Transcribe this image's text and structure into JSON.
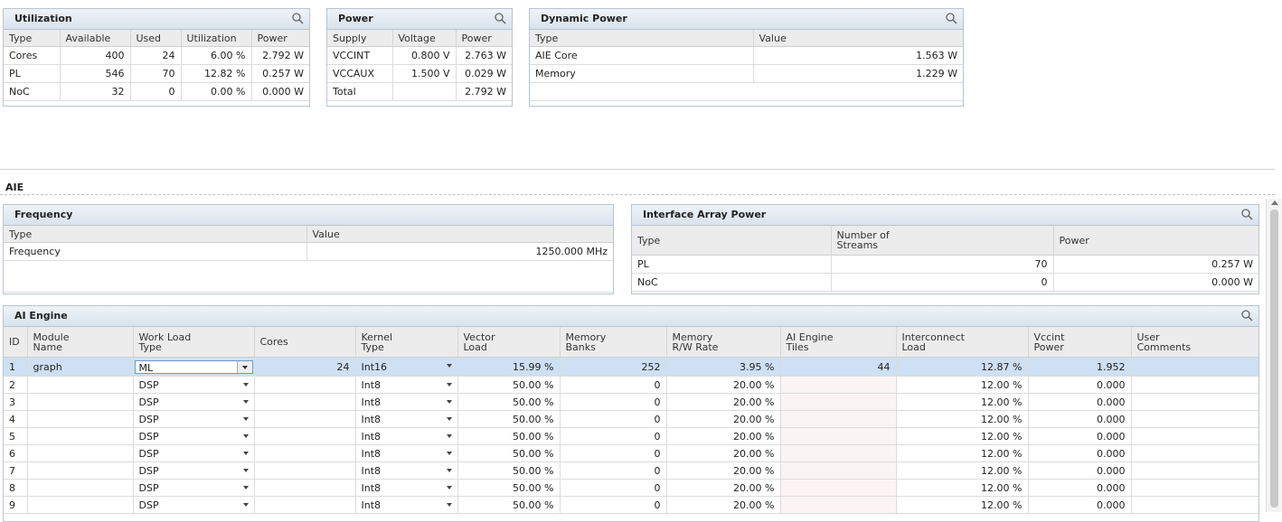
{
  "utilization": {
    "title": "Utilization",
    "headers": [
      "Type",
      "Available",
      "Used",
      "Utilization",
      "Power"
    ],
    "rows": [
      [
        "Cores",
        "400",
        "24",
        "6.00 %",
        "2.792 W"
      ],
      [
        "PL",
        "546",
        "70",
        "12.82 %",
        "0.257 W"
      ],
      [
        "NoC",
        "32",
        "0",
        "0.00 %",
        "0.000 W"
      ]
    ]
  },
  "power": {
    "title": "Power",
    "headers": [
      "Supply",
      "Voltage",
      "Power"
    ],
    "rows": [
      [
        "VCCINT",
        "0.800 V",
        "2.763 W"
      ],
      [
        "VCCAUX",
        "1.500 V",
        "0.029 W"
      ],
      [
        "Total",
        "",
        "2.792 W"
      ]
    ]
  },
  "dynamic_power": {
    "title": "Dynamic Power",
    "headers": [
      "Type",
      "Value"
    ],
    "rows": [
      [
        "AIE Core",
        "1.563 W"
      ],
      [
        "Memory",
        "1.229 W"
      ]
    ]
  },
  "section_label": "AIE",
  "frequency": {
    "title": "Frequency",
    "headers": [
      "Type",
      "Value"
    ],
    "rows": [
      [
        "Frequency",
        "1250.000 MHz"
      ]
    ]
  },
  "interface": {
    "title": "Interface Array Power",
    "headers": [
      "Type",
      "Number of\nStreams",
      "Power"
    ],
    "rows": [
      [
        "PL",
        "70",
        "0.257 W"
      ],
      [
        "NoC",
        "0",
        "0.000 W"
      ]
    ]
  },
  "ai_engine": {
    "title": "AI Engine",
    "headers": [
      "ID",
      "Module\nName",
      "Work Load\nType",
      "Cores",
      "Kernel\nType",
      "Vector\nLoad",
      "Memory\nBanks",
      "Memory\nR/W Rate",
      "AI Engine\nTiles",
      "Interconnect\nLoad",
      "Vccint\nPower",
      "User\nComments"
    ],
    "rows": [
      [
        "1",
        "graph",
        "ML",
        "24",
        "Int16",
        "15.99 %",
        "252",
        "3.95 %",
        "44",
        "12.87 %",
        "1.952",
        ""
      ],
      [
        "2",
        "",
        "DSP",
        "",
        "Int8",
        "50.00 %",
        "0",
        "20.00 %",
        "",
        "12.00 %",
        "0.000",
        ""
      ],
      [
        "3",
        "",
        "DSP",
        "",
        "Int8",
        "50.00 %",
        "0",
        "20.00 %",
        "",
        "12.00 %",
        "0.000",
        ""
      ],
      [
        "4",
        "",
        "DSP",
        "",
        "Int8",
        "50.00 %",
        "0",
        "20.00 %",
        "",
        "12.00 %",
        "0.000",
        ""
      ],
      [
        "5",
        "",
        "DSP",
        "",
        "Int8",
        "50.00 %",
        "0",
        "20.00 %",
        "",
        "12.00 %",
        "0.000",
        ""
      ],
      [
        "6",
        "",
        "DSP",
        "",
        "Int8",
        "50.00 %",
        "0",
        "20.00 %",
        "",
        "12.00 %",
        "0.000",
        ""
      ],
      [
        "7",
        "",
        "DSP",
        "",
        "Int8",
        "50.00 %",
        "0",
        "20.00 %",
        "",
        "12.00 %",
        "0.000",
        ""
      ],
      [
        "8",
        "",
        "DSP",
        "",
        "Int8",
        "50.00 %",
        "0",
        "20.00 %",
        "",
        "12.00 %",
        "0.000",
        ""
      ],
      [
        "9",
        "",
        "DSP",
        "",
        "Int8",
        "50.00 %",
        "0",
        "20.00 %",
        "",
        "12.00 %",
        "0.000",
        ""
      ]
    ]
  },
  "icons": {
    "search": "search-icon",
    "dropdown": "chevron-down-icon"
  },
  "colors": {
    "header_bg": "#d9e3ee",
    "selected_row": "#cde0f4",
    "border": "#b9c4cf"
  }
}
